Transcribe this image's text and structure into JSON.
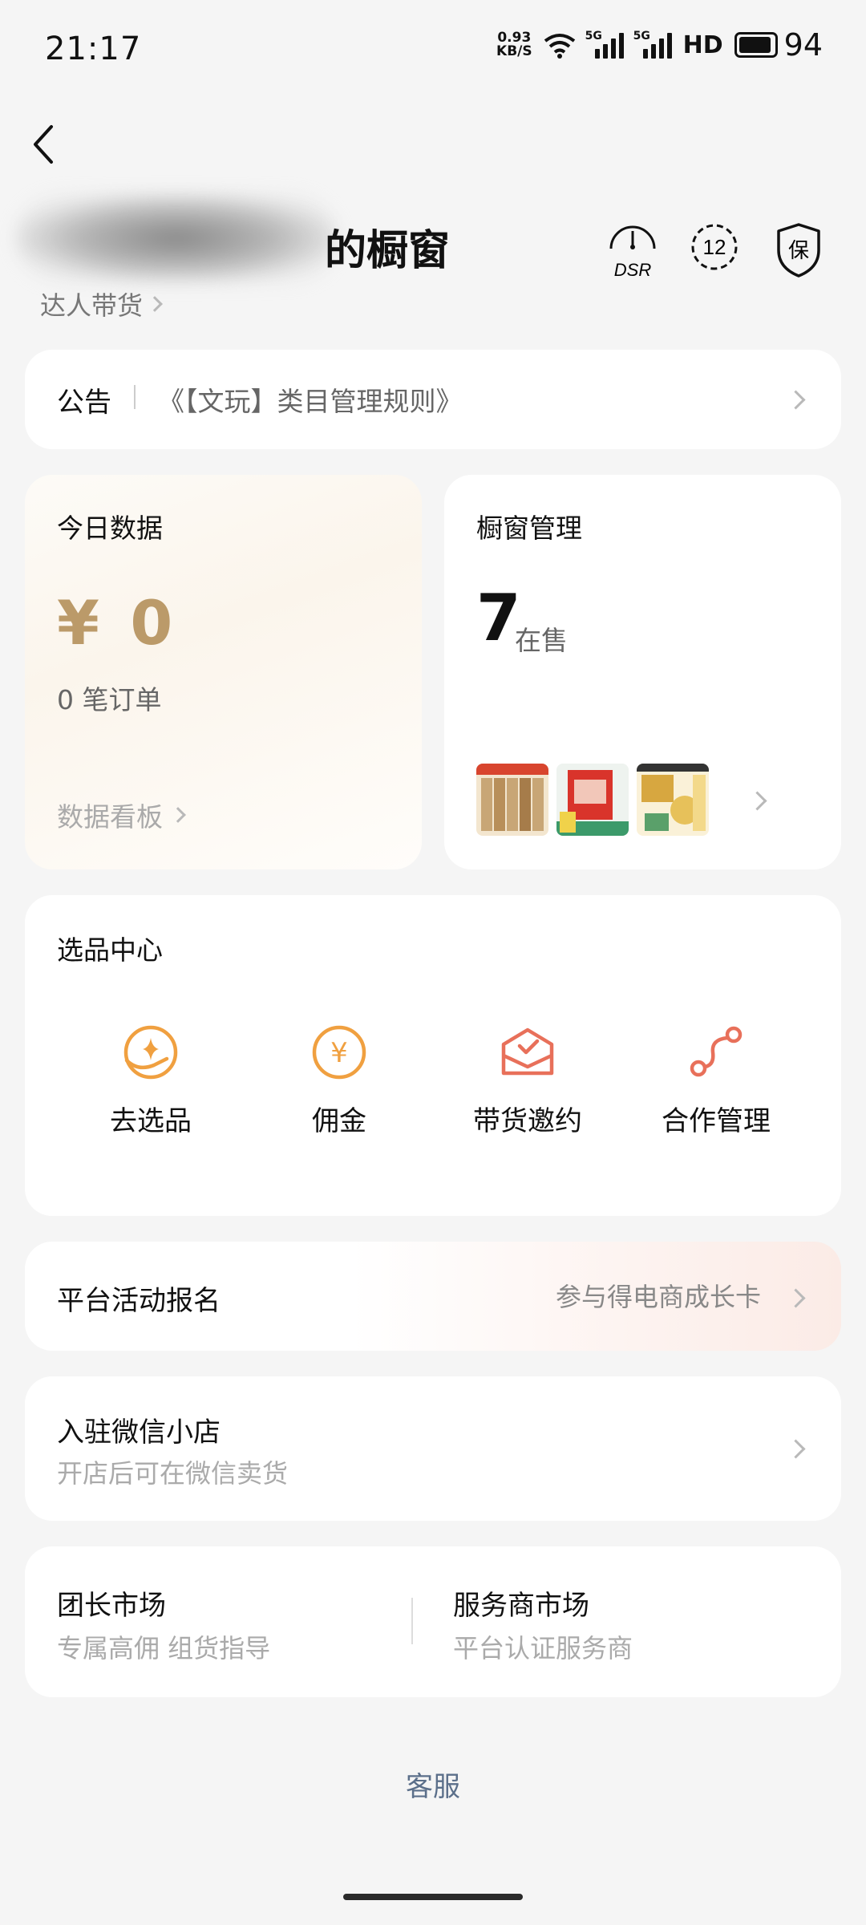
{
  "status_bar": {
    "time": "21:17",
    "net_speed_value": "0.93",
    "net_speed_unit": "KB/S",
    "sim_tag": "5G",
    "hd_label": "HD",
    "battery": "94"
  },
  "header": {
    "title_visible": "的橱窗",
    "subtitle": "达人带货",
    "icons": {
      "dsr_label": "DSR",
      "level_label": "12",
      "guarantee_label": "保"
    }
  },
  "notice": {
    "label": "公告",
    "text": "《【文玩】类目管理规则》"
  },
  "today": {
    "title": "今日数据",
    "amount": "¥ 0",
    "orders": "0 笔订单",
    "board_link": "数据看板"
  },
  "window_mgmt": {
    "title": "橱窗管理",
    "count": "7",
    "unit": "在售"
  },
  "selection_center": {
    "title": "选品中心",
    "tools": [
      {
        "label": "去选品",
        "icon": "select-product-icon"
      },
      {
        "label": "佣金",
        "icon": "yuan-coin-icon"
      },
      {
        "label": "带货邀约",
        "icon": "invite-envelope-icon"
      },
      {
        "label": "合作管理",
        "icon": "cooperation-path-icon"
      }
    ]
  },
  "activity": {
    "title": "平台活动报名",
    "right_text": "参与得电商成长卡"
  },
  "wechat_shop": {
    "title": "入驻微信小店",
    "subtitle": "开店后可在微信卖货"
  },
  "markets": [
    {
      "title": "团长市场",
      "subtitle": "专属高佣 组货指导"
    },
    {
      "title": "服务商市场",
      "subtitle": "平台认证服务商"
    }
  ],
  "footer": {
    "service": "客服"
  },
  "colors": {
    "accent_gold": "#bb9a69",
    "icon_orange": "#f0a040",
    "icon_red": "#e8705a",
    "link_blue": "#5b6f8a"
  }
}
